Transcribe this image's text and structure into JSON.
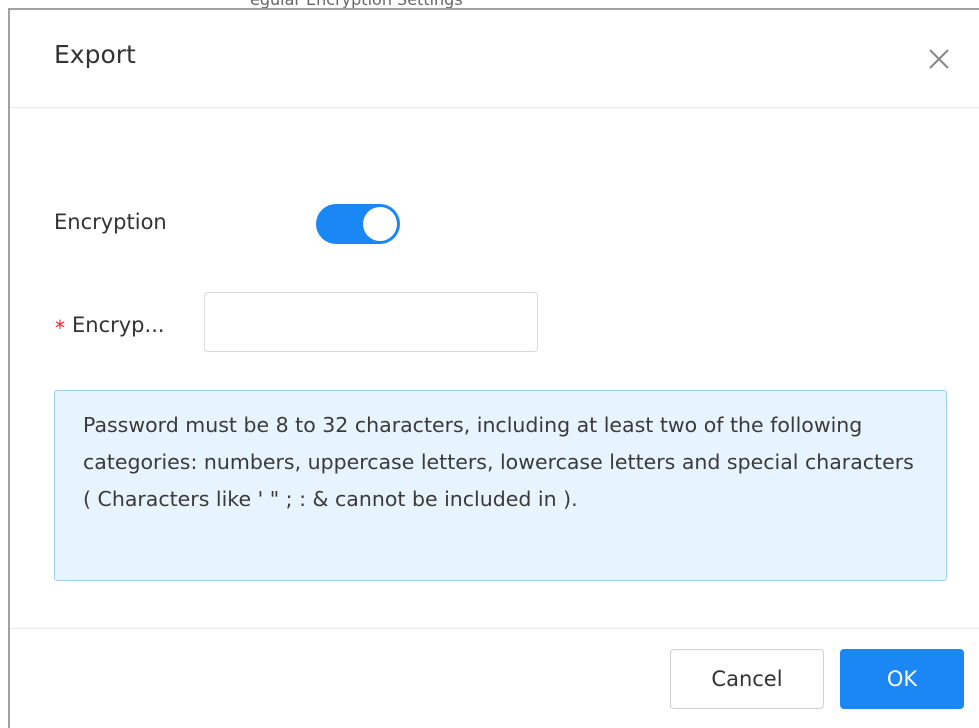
{
  "dialog": {
    "title": "Export",
    "close_icon": "close-icon",
    "partial_top_text": "egular Encryption Settings"
  },
  "encryption": {
    "label": "Encryption",
    "toggle_on": true,
    "accent_color": "#1a87f5"
  },
  "password": {
    "required_mark": "*",
    "label": "Encryp...",
    "value": "",
    "placeholder": ""
  },
  "hint": {
    "text": "Password must be 8 to 32 characters, including at least two of the following categories: numbers, uppercase letters, lowercase letters and special characters ( Characters like ' \" ; : & cannot be included in )."
  },
  "footer": {
    "cancel_label": "Cancel",
    "ok_label": "OK"
  }
}
